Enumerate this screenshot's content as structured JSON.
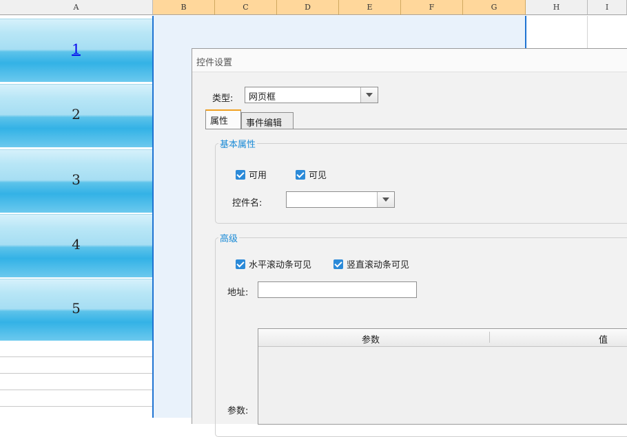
{
  "columns": [
    "A",
    "B",
    "C",
    "D",
    "E",
    "F",
    "G",
    "H",
    "I"
  ],
  "selected_columns": [
    "B",
    "C",
    "D",
    "E",
    "F",
    "G"
  ],
  "row_buttons": [
    "1",
    "2",
    "3",
    "4",
    "5"
  ],
  "dialog": {
    "title": "控件设置",
    "type_label": "类型:",
    "type_value": "网页框",
    "tabs": [
      "属性",
      "事件编辑"
    ],
    "active_tab": "属性",
    "basic_group": {
      "title": "基本属性",
      "enabled_label": "可用",
      "enabled_checked": true,
      "visible_label": "可见",
      "visible_checked": true,
      "control_name_label": "控件名:",
      "control_name_value": ""
    },
    "advanced_group": {
      "title": "高级",
      "hscroll_label": "水平滚动条可见",
      "hscroll_checked": true,
      "vscroll_label": "竖直滚动条可见",
      "vscroll_checked": true,
      "url_label": "地址:",
      "url_value": "",
      "params_label": "参数:",
      "params_table": {
        "headers": [
          "参数",
          "值"
        ],
        "rows": []
      }
    }
  },
  "colors": {
    "selection": "#1e73d2",
    "tab_accent": "#f0a020",
    "checkbox": "#2b8ad8",
    "group_title": "#1b8bd6"
  }
}
